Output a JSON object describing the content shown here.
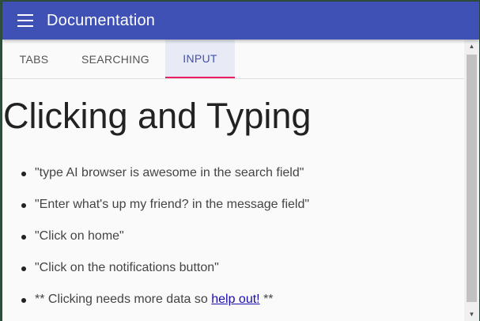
{
  "appbar": {
    "title": "Documentation",
    "menu_icon": "hamburger-menu-icon",
    "color": "#3f51b5"
  },
  "tabs": [
    {
      "label": "TABS",
      "active": false
    },
    {
      "label": "SEARCHING",
      "active": false
    },
    {
      "label": "INPUT",
      "active": true
    }
  ],
  "tab_indicator_color": "#e91e63",
  "content": {
    "heading": "Clicking and Typing",
    "items": [
      "\"type AI browser is awesome in the search field\"",
      "\"Enter what's up my friend? in the message field\"",
      "\"Click on home\"",
      "\"Click on the notifications button\""
    ],
    "last_item": {
      "prefix": "** Clicking needs more data so ",
      "link": "help out!",
      "suffix": " **"
    }
  },
  "scrollbar": {
    "up_icon": "scroll-up-arrow-icon",
    "down_icon": "scroll-down-arrow-icon"
  }
}
